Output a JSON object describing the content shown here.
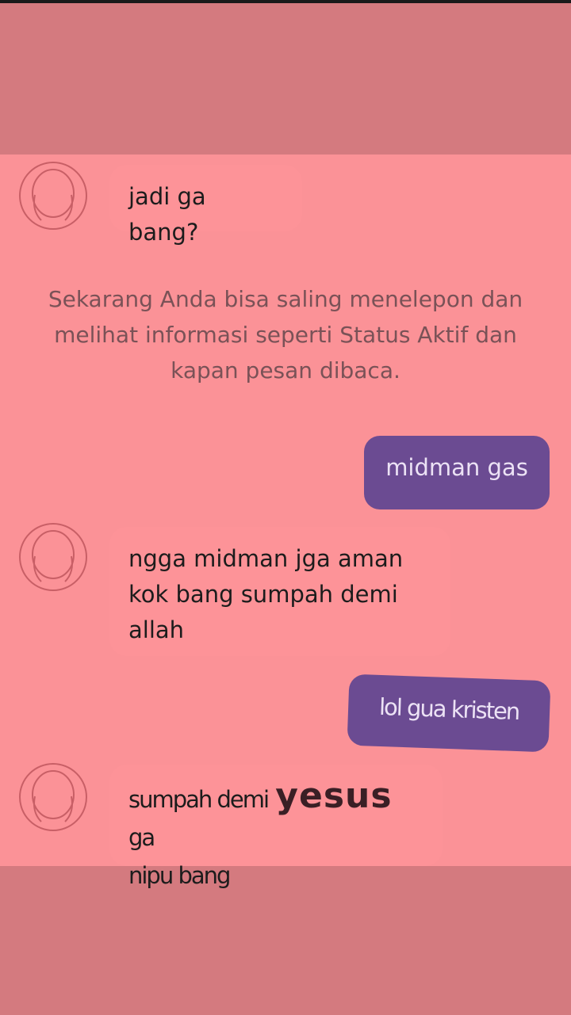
{
  "messages": [
    {
      "sender": "other",
      "text": "jadi ga bang?"
    },
    {
      "sender": "system",
      "text": "Sekarang Anda bisa saling menelepon dan melihat informasi seperti Status Aktif dan kapan pesan dibaca."
    },
    {
      "sender": "me",
      "text": "midman gas"
    },
    {
      "sender": "other",
      "line1": "ngga midman jga aman",
      "line2": "kok bang sumpah demi",
      "line3": "allah"
    },
    {
      "sender": "me",
      "text": "lol gua kristen"
    },
    {
      "sender": "other",
      "part1": "sumpah demi",
      "emph": "yesus",
      "part2": "ga",
      "line2": "nipu bang"
    }
  ],
  "colors": {
    "background_dim": "#d47a7f",
    "chat_background": "#fb9297",
    "outgoing_bubble": "#6b4b92",
    "system_text": "#7a5257"
  },
  "icons": {
    "avatar": "default-profile-silhouette"
  }
}
